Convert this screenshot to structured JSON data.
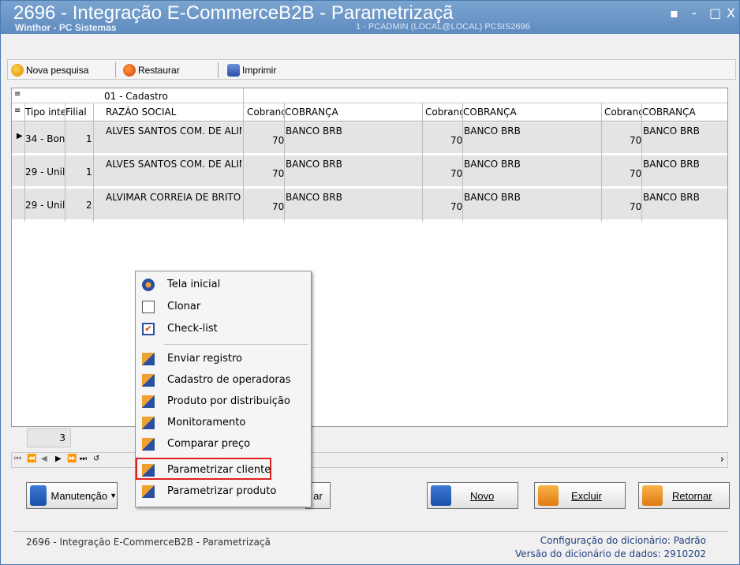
{
  "window": {
    "title": "2696 - Integração E-CommerceB2B - Parametrizaçã",
    "subtitle": "Winthor - PC Sistemas",
    "session_info": "1 - PCADMIN (LOCAL@LOCAL)   PCSIS2696",
    "controls": [
      "▪",
      "-",
      "□",
      "X"
    ]
  },
  "toolbar": {
    "new_search_label": "Nova pesquisa",
    "restore_label": "Restaurar",
    "print_label": "Imprimir"
  },
  "grid": {
    "band_label": "01 - Cadastro",
    "columns": [
      "Tipo inte",
      "Filial",
      "RAZÃO SOCIAL",
      "Cobranç",
      "COBRANÇA",
      "Cobranç",
      "COBRANÇA",
      "Cobranç",
      "COBRANÇA"
    ],
    "rows": [
      [
        "34 - Bon",
        "1",
        "ALVES SANTOS COM. DE ALIN",
        "70",
        "BANCO BRB",
        "70",
        "BANCO BRB",
        "70",
        "BANCO BRB"
      ],
      [
        "29 - Unil",
        "1",
        "ALVES SANTOS COM. DE ALIN",
        "70",
        "BANCO BRB",
        "70",
        "BANCO BRB",
        "70",
        "BANCO BRB"
      ],
      [
        "29 - Unil",
        "2",
        "ALVIMAR CORREIA DE BRITO",
        "70",
        "BANCO BRB",
        "70",
        "BANCO BRB",
        "70",
        "BANCO BRB"
      ]
    ],
    "record_count": "3"
  },
  "context_menu": {
    "items": [
      {
        "label": "Tela inicial",
        "icon": "home-icon"
      },
      {
        "label": "Clonar",
        "icon": "clone-icon"
      },
      {
        "label": "Check-list",
        "icon": "checklist-icon"
      },
      {
        "label": "Enviar registro",
        "icon": "folder-icon"
      },
      {
        "label": "Cadastro de operadoras",
        "icon": "folder-icon"
      },
      {
        "label": "Produto por distribuição",
        "icon": "folder-icon"
      },
      {
        "label": "Monitoramento",
        "icon": "folder-icon"
      },
      {
        "label": "Comparar preço",
        "icon": "folder-icon"
      },
      {
        "label": "Parametrizar cliente",
        "icon": "folder-icon"
      },
      {
        "label": "Parametrizar produto",
        "icon": "folder-icon"
      }
    ],
    "highlighted": "Parametrizar cliente"
  },
  "buttons": {
    "manutencao": "Manutenção",
    "hidden_partial": "ar",
    "novo": "Novo",
    "excluir": "Excluir",
    "retornar": "Retornar"
  },
  "status": {
    "left": "2696 - Integração E-CommerceB2B - Parametrizaçã",
    "dict_config_label": "Configuração do dicionário:",
    "dict_config_value": "Padrão",
    "dict_version_label": "Versão do dicionário de dados:",
    "dict_version_value": "2910202"
  },
  "colors": {
    "title_bar": "#5f8bbf",
    "row_bg": "#e4e4e4",
    "highlight_border": "#e02020",
    "status_text": "#1f3f7f"
  }
}
